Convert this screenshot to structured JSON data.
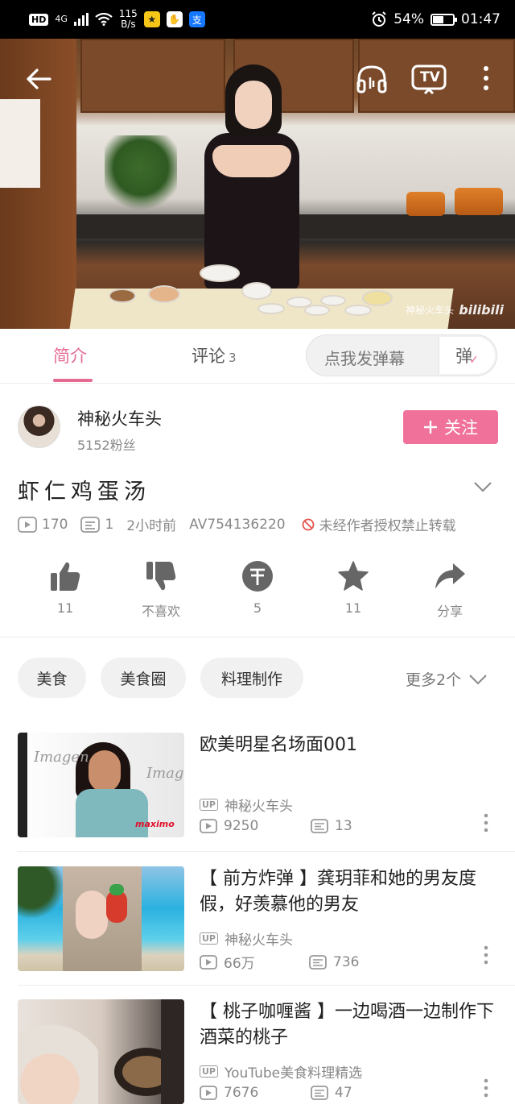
{
  "status_bar": {
    "hd": "HD",
    "network": "4G",
    "speed_value": "115",
    "speed_unit": "B/s",
    "battery": "54%",
    "battery_fraction": 0.54,
    "time": "01:47"
  },
  "video": {
    "watermark_name": "神秘火车头",
    "watermark_logo": "bilibili",
    "tv_label": "TV"
  },
  "tabs": {
    "intro": "简介",
    "comments": "评论",
    "comments_count": "3",
    "danmu_placeholder": "点我发弹幕",
    "danmu_button": "弹"
  },
  "uploader": {
    "name": "神秘火车头",
    "fans": "5152粉丝",
    "follow": "关注"
  },
  "video_info": {
    "title": "虾仁鸡蛋汤",
    "plays": "170",
    "danmaku": "1",
    "time_ago": "2小时前",
    "av": "AV754136220",
    "notice": "未经作者授权禁止转载"
  },
  "actions": {
    "like": "11",
    "dislike": "不喜欢",
    "coin": "5",
    "favorite": "11",
    "share": "分享"
  },
  "tags": {
    "items": [
      "美食",
      "美食圈",
      "料理制作"
    ],
    "more": "更多2个"
  },
  "related": [
    {
      "title": "欧美明星名场面001",
      "uploader": "神秘火车头",
      "plays": "9250",
      "danmaku": "13",
      "thumb_text": "maximo"
    },
    {
      "title": "【 前方炸弹 】龚玥菲和她的男友度假，好羡慕他的男友",
      "uploader": "神秘火车头",
      "plays": "66万",
      "danmaku": "736"
    },
    {
      "title": "【 桃子咖喱酱 】一边喝酒一边制作下酒菜的桃子",
      "uploader": "YouTube美食料理精选",
      "plays": "7676",
      "danmaku": "47"
    }
  ],
  "colors": {
    "accent": "#e56b92",
    "follow_bg": "#f0719a",
    "status_bar_bg": "#000000"
  }
}
